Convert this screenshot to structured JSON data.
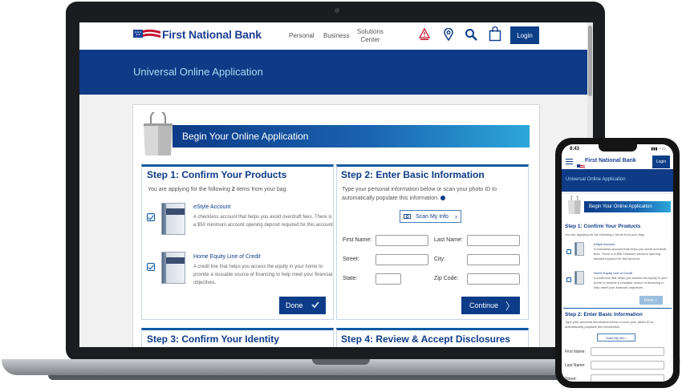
{
  "colors": {
    "navy": "#0d3b87",
    "banner": "#0f3a86",
    "banner_text": "#a8dcf2",
    "accent": "#2da7db"
  },
  "header": {
    "brand": "First National Bank",
    "nav": [
      "Personal",
      "Business",
      "Solutions\nCenter"
    ],
    "icons": [
      "alert-icon",
      "location-pin-icon",
      "search-icon",
      "shopping-bag-icon"
    ],
    "login": "Login"
  },
  "banner": {
    "title": "Universal Online Application"
  },
  "begin": {
    "title": "Begin Your Online Application"
  },
  "step1": {
    "title": "Step 1: Confirm Your Products",
    "intro_prefix": "You are applying for the following ",
    "intro_count": "2",
    "intro_suffix": " items from your bag.",
    "items": [
      {
        "title": "eStyle Account",
        "desc": "A checkless account that helps you avoid overdraft fees. There is a $50 minimum account opening deposit required for this account."
      },
      {
        "title": "Home Equity Line of Credit",
        "desc": "A credit line that helps you access the equity in your home to provide a reusable source of financing to help meet your financial objectives."
      }
    ],
    "done": "Done"
  },
  "step2": {
    "title": "Step 2: Enter Basic Information",
    "intro": "Type your personal information below or scan your photo ID to automatically populate this information.",
    "scan": "Scan My Info",
    "labels": {
      "first": "First Name:",
      "last": "Last Name:",
      "street": "Street:",
      "city": "City:",
      "state": "State:",
      "zip": "Zip Code:"
    },
    "continue": "Continue"
  },
  "step3": {
    "title": "Step 3: Confirm Your Identity"
  },
  "step4": {
    "title": "Step 4: Review & Accept Disclosures"
  },
  "phone": {
    "time": "8:43",
    "brand": "First National Bank",
    "login": "Login",
    "banner": "Universal Online Application",
    "begin": "Begin Your Online Application",
    "step1_title": "Step 1: Confirm Your Products",
    "step1_intro": "You are applying for the following 2 items from your bag.",
    "item1_title": "eStyle Account",
    "item1_desc": "A checkless account that helps you avoid overdraft fees. There is a $50 minimum account opening deposit required for this account.",
    "item2_title": "Home Equity Line of Credit",
    "item2_desc": "A credit line that helps you access the equity in your home to provide a reusable source of financing to help meet your financial objectives.",
    "done": "Done",
    "step2_title": "Step 2: Enter Basic Information",
    "step2_intro": "Type your personal information below or scan your photo ID to automatically populate this information.",
    "scan": "Scan My Info",
    "first": "First Name:",
    "last": "Last Name:",
    "street": "Street:"
  }
}
